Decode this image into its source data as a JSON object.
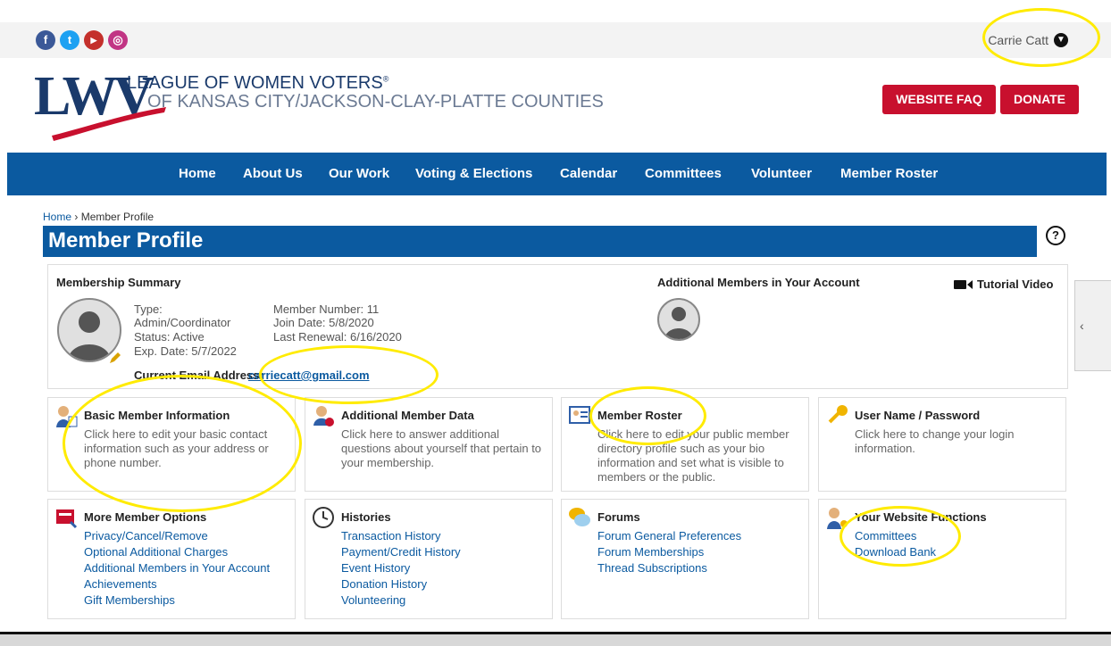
{
  "social": [
    {
      "icon": "facebook-icon",
      "glyph": "f",
      "color": "#3b5998"
    },
    {
      "icon": "twitter-icon",
      "glyph": "t",
      "color": "#1da1f2"
    },
    {
      "icon": "youtube-icon",
      "glyph": "▶",
      "color": "#c4302b"
    },
    {
      "icon": "instagram-icon",
      "glyph": "◎",
      "color": "#c13584"
    }
  ],
  "user": {
    "name": "Carrie Catt"
  },
  "logo": {
    "mark": "LWV",
    "line1": "LEAGUE OF WOMEN VOTERS",
    "registered": "®",
    "line2": "OF KANSAS CITY/JACKSON-CLAY-PLATTE COUNTIES"
  },
  "header_buttons": {
    "faq": "WEBSITE FAQ",
    "donate": "DONATE"
  },
  "nav": [
    "Home",
    "About Us",
    "Our Work",
    "Voting & Elections",
    "Calendar",
    "Committees",
    "Volunteer",
    "Member Roster"
  ],
  "breadcrumb": {
    "home": "Home",
    "sep": "›",
    "current": "Member Profile"
  },
  "page_title": "Member Profile",
  "help_glyph": "?",
  "summary": {
    "title": "Membership Summary",
    "type_label": "Type:",
    "type_value": "Admin/Coordinator",
    "status": "Status: Active",
    "exp": "Exp. Date: 5/7/2022",
    "member_number": "Member Number: 11",
    "join_date": "Join Date: 5/8/2020",
    "last_renewal": "Last Renewal: 6/16/2020",
    "email_label": "Current Email Address:",
    "email": "carriecatt@gmail.com",
    "additional_title": "Additional Members in Your Account",
    "tutorial": "Tutorial Video"
  },
  "cards_row1": [
    {
      "title": "Basic Member Information",
      "desc": "Click here to edit your basic contact information such as your address or phone number."
    },
    {
      "title": "Additional Member Data",
      "desc": "Click here to answer additional questions about yourself that pertain to your membership."
    },
    {
      "title": "Member Roster",
      "desc": "Click here to edit your public member directory profile such as your bio information and set what is visible to members or the public."
    },
    {
      "title": "User Name / Password",
      "desc": "Click here to change your login information."
    }
  ],
  "cards_row2": [
    {
      "title": "More Member Options",
      "links": [
        "Privacy/Cancel/Remove",
        "Optional Additional Charges",
        "Additional Members in Your Account",
        "Achievements",
        "Gift Memberships"
      ]
    },
    {
      "title": "Histories",
      "links": [
        "Transaction History",
        "Payment/Credit History",
        "Event History",
        "Donation History",
        "Volunteering"
      ]
    },
    {
      "title": "Forums",
      "links": [
        "Forum General Preferences",
        "Forum Memberships",
        "Thread Subscriptions"
      ]
    },
    {
      "title": "Your Website Functions",
      "links": [
        "Committees",
        "Download Bank"
      ]
    }
  ],
  "colors": {
    "brand_blue": "#0b5aa0",
    "red": "#c8102e",
    "highlight": "#ffeb00"
  }
}
